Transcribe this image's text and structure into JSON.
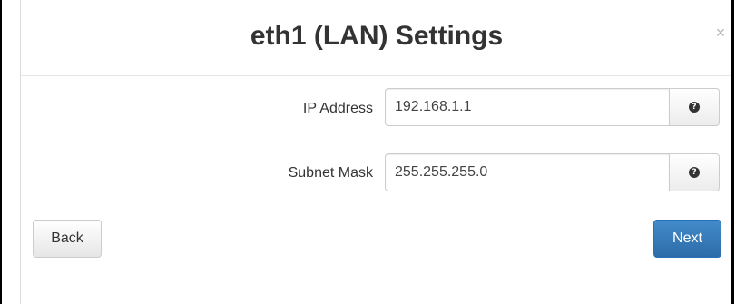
{
  "dialog": {
    "title": "eth1 (LAN) Settings",
    "close_label": "×"
  },
  "fields": [
    {
      "label": "IP Address",
      "value": "192.168.1.1",
      "help_icon": "question-circle-icon"
    },
    {
      "label": "Subnet Mask",
      "value": "255.255.255.0",
      "help_icon": "question-circle-icon"
    }
  ],
  "help_glyph": "?",
  "buttons": {
    "back_label": "Back",
    "next_label": "Next"
  },
  "colors": {
    "primary": "#337ab7",
    "text": "#333333"
  }
}
